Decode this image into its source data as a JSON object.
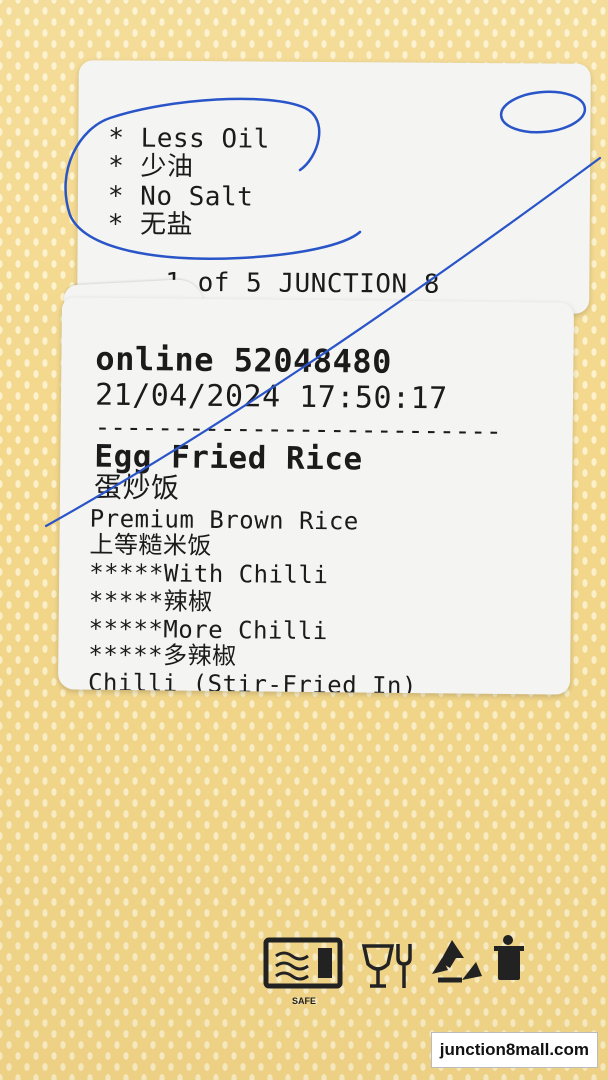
{
  "top_label": {
    "options": [
      "* Less Oil",
      "* 少油",
      "* No Salt",
      "* 无盐"
    ],
    "counter": "1 of 5 JUNCTION 8"
  },
  "receipt": {
    "order": "online 52048480",
    "datetime": "21/04/2024 17:50:17",
    "separator": "--------------------------",
    "item": "Egg Fried Rice",
    "item_cn": "蛋炒饭",
    "lines": [
      "Premium Brown Rice",
      "上等糙米饭",
      "*****With Chilli",
      "*****辣椒",
      "*****More Chilli",
      "*****多辣椒",
      "Chilli (Stir-Fried In)"
    ]
  },
  "package_icons": [
    "microwave-safe-icon",
    "food-safe-icon",
    "recycle-icon",
    "dispose-bin-icon"
  ],
  "package_icon_caption": "SAFE",
  "watermark": "junction8mall.com",
  "colors": {
    "box": "#f3d88c",
    "label": "#f4f4f2",
    "pen": "#2a55c8"
  }
}
